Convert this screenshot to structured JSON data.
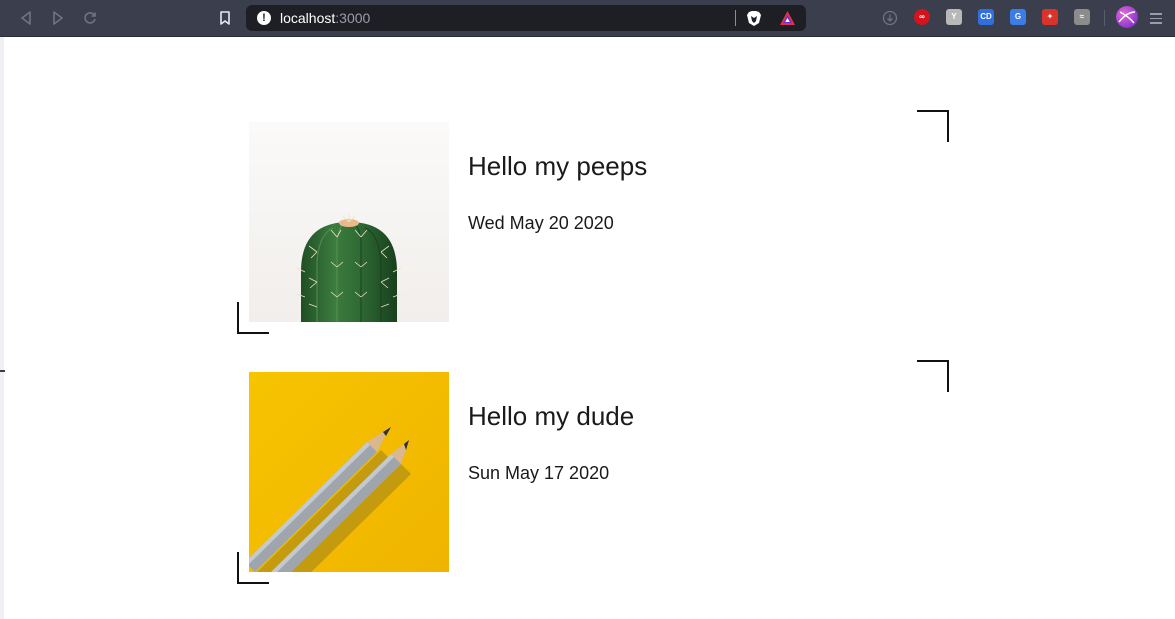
{
  "browser": {
    "url_host": "localhost",
    "url_port": ":3000",
    "extensions": [
      {
        "name": "creative-cloud-icon",
        "color": "#d4141c",
        "glyph": "∞"
      },
      {
        "name": "hackernews-icon",
        "color": "#b8b8b8",
        "glyph": "Y"
      },
      {
        "name": "cd-extension-icon",
        "color": "#2f6fe0",
        "glyph": "CD"
      },
      {
        "name": "google-translate-icon",
        "color": "#3a7de8",
        "glyph": "G"
      },
      {
        "name": "red-extension-icon",
        "color": "#d9342b",
        "glyph": "✦"
      },
      {
        "name": "grey-extension-icon",
        "color": "#8c8c8c",
        "glyph": "≈"
      }
    ]
  },
  "posts": [
    {
      "title": "Hello my peeps",
      "date": "Wed May 20 2020",
      "image": "cactus-image"
    },
    {
      "title": "Hello my dude",
      "date": "Sun May 17 2020",
      "image": "pencils-image"
    }
  ],
  "colors": {
    "chrome": "#3b3e4c",
    "url_bar": "#1e1f25",
    "text": "#1a1a1a",
    "pencil_background": "#f6c000",
    "cactus_background": "#f8f6f4",
    "cactus_green": "#2f6b34"
  }
}
